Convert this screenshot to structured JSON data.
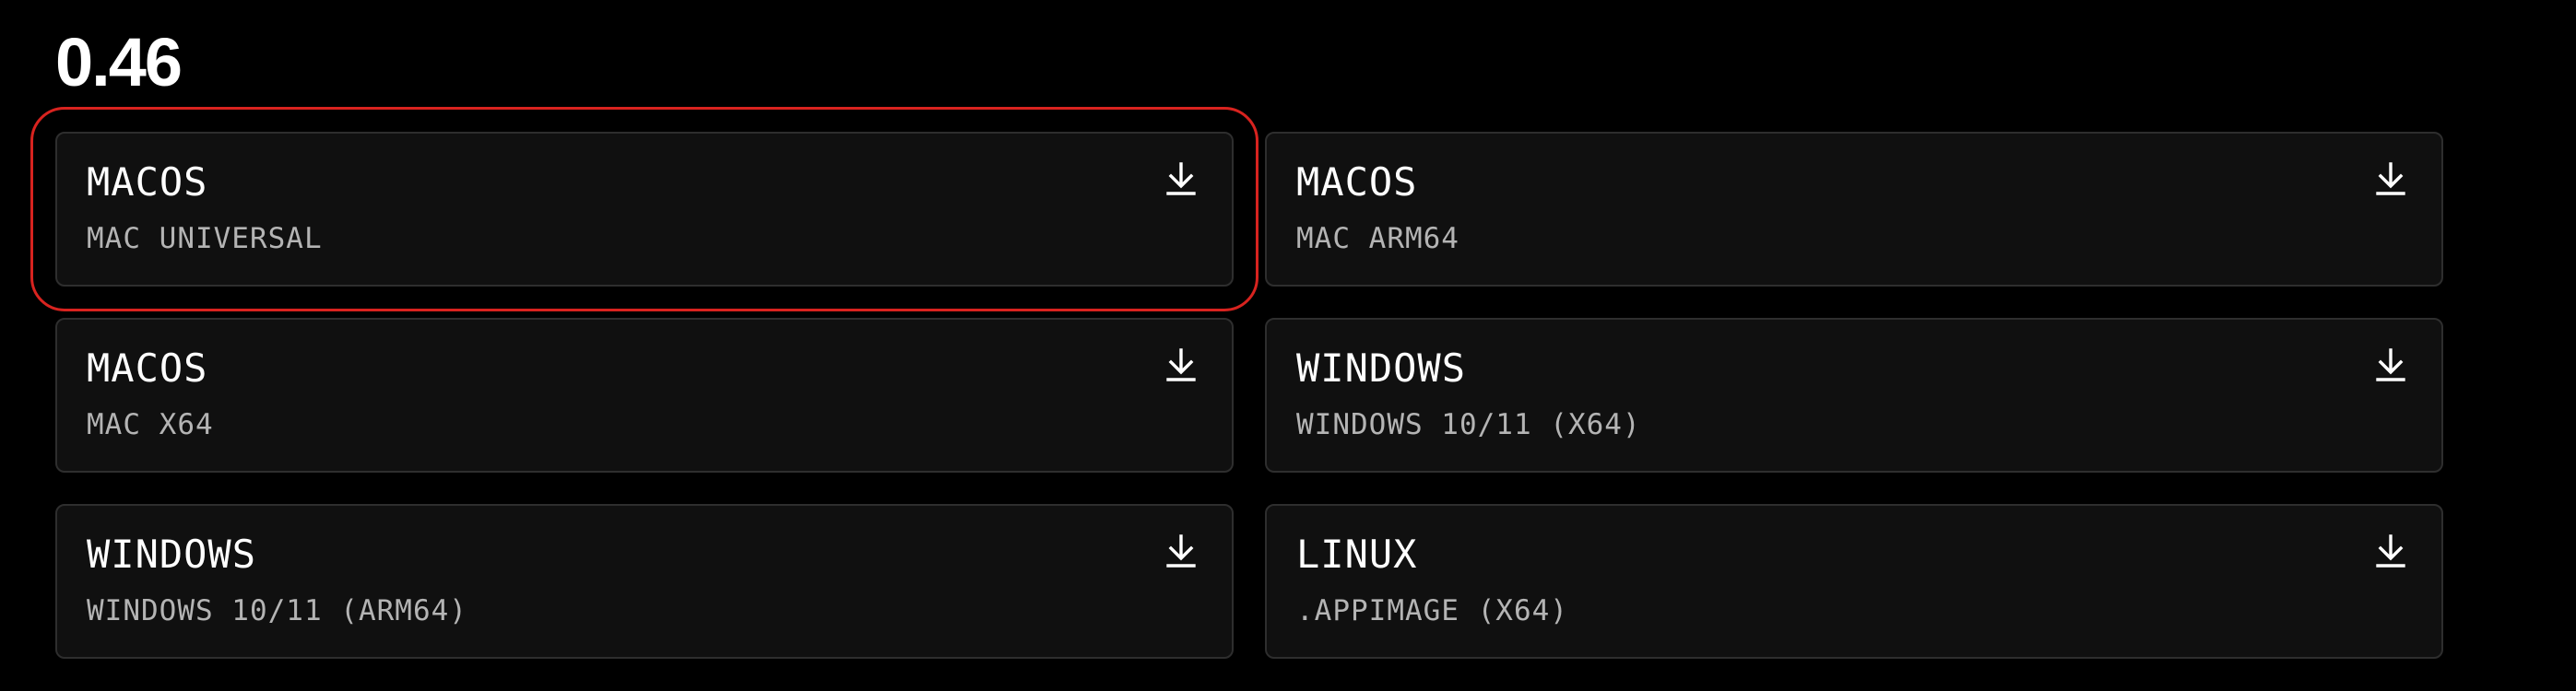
{
  "version": "0.46",
  "downloads": [
    {
      "os": "MACOS",
      "variant": "MAC UNIVERSAL",
      "icon": "download-icon",
      "highlighted": true
    },
    {
      "os": "MACOS",
      "variant": "MAC ARM64",
      "icon": "download-icon"
    },
    {
      "os": "MACOS",
      "variant": "MAC X64",
      "icon": "download-icon"
    },
    {
      "os": "WINDOWS",
      "variant": "WINDOWS 10/11 (X64)",
      "icon": "download-icon"
    },
    {
      "os": "WINDOWS",
      "variant": "WINDOWS 10/11 (ARM64)",
      "icon": "download-icon"
    },
    {
      "os": "LINUX",
      "variant": ".APPIMAGE (X64)",
      "icon": "download-icon"
    }
  ],
  "colors": {
    "background": "#000000",
    "card_background": "#101010",
    "card_border": "#2e2e2e",
    "highlight": "#d8231f",
    "secondary_text": "#b4b4b4"
  }
}
